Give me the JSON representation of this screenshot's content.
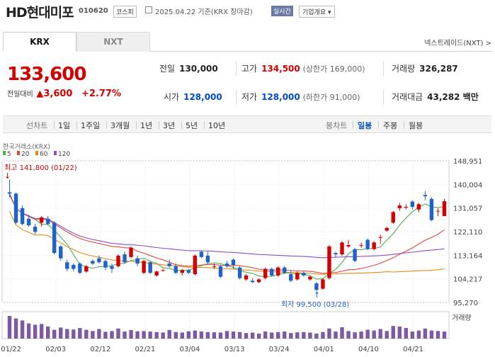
{
  "header": {
    "company": "HD현대미포",
    "code": "010620",
    "market": "코스피",
    "date_text": "2025.04.22  기준(KRX 장마감)",
    "realtime_label": "실시간",
    "company_info_label": "기업개요 ▾"
  },
  "tabs": [
    "KRX",
    "NXT"
  ],
  "nextrade_link": "넥스트레이드(NXT) >",
  "quote": {
    "price": "133,600",
    "change_label": "전일대비",
    "change": "▲3,600",
    "change_pct": "+2.77%"
  },
  "stats": {
    "prev_label": "전일",
    "prev": "130,000",
    "high_label": "고가",
    "high": "134,500",
    "upper_limit": "(상한가 169,000)",
    "volume_label": "거래량",
    "volume": "326,287",
    "open_label": "시가",
    "open": "128,000",
    "low_label": "저가",
    "low": "128,000",
    "lower_limit": "(하한가 91,000)",
    "amount_label": "거래대금",
    "amount": "43,282 백만"
  },
  "toolbar": {
    "line_chart": "선차트",
    "periods": [
      "1일",
      "1주일",
      "3개월",
      "1년",
      "3년",
      "5년",
      "10년"
    ],
    "candle_chart": "봉차트",
    "candle_periods": [
      "일봉",
      "주봉",
      "월봉"
    ]
  },
  "chart_data": {
    "type": "candlestick",
    "source_label": "한국거래소(KRX)",
    "legend": [
      {
        "name": "5",
        "color": "#4caf50"
      },
      {
        "name": "20",
        "color": "#e0463c"
      },
      {
        "name": "60",
        "color": "#e38a14"
      },
      {
        "name": "120",
        "color": "#8a4fc8"
      }
    ],
    "up_color": "#d20000",
    "down_color": "#1e63c8",
    "y_ticks": [
      "148,951",
      "140,004",
      "131,057",
      "122,110",
      "113,164",
      "104,217",
      "95,270"
    ],
    "ylim": [
      95270,
      148951
    ],
    "x_ticks": [
      "01/22",
      "02/03",
      "02/12",
      "02/21",
      "03/04",
      "03/13",
      "03/24",
      "04/01",
      "04/10",
      "04/21"
    ],
    "high_annotation": "최고 141,800 (01/22)",
    "low_annotation": "최저 99,500 (03/28)",
    "volume_label": "거래량",
    "candles": [
      [
        137000,
        141800,
        135000,
        136500
      ],
      [
        136500,
        137000,
        125000,
        125500
      ],
      [
        131000,
        132000,
        124500,
        125000
      ],
      [
        127000,
        128500,
        124000,
        124500
      ],
      [
        124000,
        125000,
        121000,
        122000
      ],
      [
        125500,
        128000,
        124000,
        127500
      ],
      [
        127000,
        128000,
        124500,
        125000
      ],
      [
        125500,
        126000,
        113500,
        114000
      ],
      [
        116500,
        117000,
        111000,
        112000
      ],
      [
        110500,
        111500,
        107000,
        108000
      ],
      [
        109500,
        110000,
        107000,
        108000
      ],
      [
        110000,
        110500,
        106000,
        106500
      ],
      [
        107000,
        109500,
        106500,
        109000
      ],
      [
        111000,
        111500,
        109500,
        110000
      ],
      [
        112000,
        113000,
        110000,
        110500
      ],
      [
        111000,
        111500,
        107500,
        108500
      ],
      [
        109000,
        110000,
        106500,
        108000
      ],
      [
        109000,
        113500,
        108500,
        113000
      ],
      [
        113500,
        114500,
        110000,
        110500
      ],
      [
        112500,
        116500,
        112000,
        116000
      ],
      [
        112000,
        113000,
        109000,
        110000
      ],
      [
        106500,
        111500,
        106000,
        111000
      ],
      [
        110500,
        111000,
        106000,
        106500
      ],
      [
        105500,
        107500,
        105000,
        107000
      ],
      [
        107500,
        108000,
        107000,
        107500
      ],
      [
        110000,
        111500,
        108500,
        109000
      ],
      [
        109000,
        110000,
        106000,
        106500
      ],
      [
        106500,
        108000,
        105500,
        107500
      ],
      [
        107500,
        108000,
        106000,
        106500
      ],
      [
        106000,
        113500,
        105500,
        113000
      ],
      [
        114500,
        115000,
        112000,
        112500
      ],
      [
        113000,
        114500,
        110000,
        110500
      ],
      [
        109000,
        110000,
        108000,
        109000
      ],
      [
        109000,
        109500,
        104500,
        105000
      ],
      [
        110000,
        111000,
        108500,
        109000
      ],
      [
        111500,
        112000,
        108000,
        109500
      ],
      [
        108500,
        109000,
        104000,
        104500
      ],
      [
        104000,
        106000,
        103500,
        105500
      ],
      [
        103500,
        104500,
        102500,
        103000
      ],
      [
        103000,
        104500,
        102500,
        104000
      ],
      [
        104500,
        108500,
        104000,
        108000
      ],
      [
        108000,
        108500,
        105000,
        105500
      ],
      [
        105500,
        109000,
        105000,
        108500
      ],
      [
        108500,
        109000,
        106000,
        106500
      ],
      [
        106000,
        107500,
        103000,
        103500
      ],
      [
        104000,
        107000,
        103500,
        106500
      ],
      [
        106500,
        107000,
        105000,
        105500
      ],
      [
        104000,
        105500,
        103500,
        105000
      ],
      [
        102500,
        103000,
        99500,
        100000
      ],
      [
        100500,
        104500,
        100000,
        104000
      ],
      [
        104500,
        117000,
        104000,
        116500
      ],
      [
        114000,
        114500,
        112500,
        113500
      ],
      [
        113500,
        118500,
        113000,
        118000
      ],
      [
        116500,
        119000,
        116000,
        117000
      ],
      [
        115500,
        116000,
        110500,
        111000
      ],
      [
        117000,
        118000,
        116000,
        117000
      ],
      [
        119000,
        119500,
        115000,
        115500
      ],
      [
        115500,
        118500,
        115000,
        118000
      ],
      [
        120000,
        121000,
        117500,
        120000
      ],
      [
        122500,
        124000,
        122000,
        123500
      ],
      [
        125500,
        130000,
        125000,
        129500
      ],
      [
        131000,
        133000,
        130000,
        132000
      ],
      [
        131500,
        132500,
        130500,
        131500
      ],
      [
        133500,
        134000,
        130500,
        131500
      ],
      [
        130500,
        133000,
        129500,
        132500
      ],
      [
        136000,
        137500,
        134000,
        135500
      ],
      [
        134500,
        135000,
        126000,
        126500
      ],
      [
        130000,
        131000,
        128000,
        130000
      ],
      [
        128000,
        134500,
        128000,
        133600
      ]
    ],
    "volumes": [
      90,
      80,
      72,
      60,
      55,
      58,
      48,
      35,
      44,
      38,
      36,
      42,
      35,
      30,
      38,
      27,
      30,
      40,
      28,
      34,
      29,
      30,
      28,
      26,
      24,
      34,
      26,
      24,
      29,
      32,
      28,
      26,
      25,
      24,
      30,
      28,
      26,
      22,
      24,
      20,
      28,
      24,
      26,
      28,
      22,
      25,
      26,
      24,
      20,
      26,
      40,
      28,
      45,
      30,
      25,
      28,
      35,
      32,
      38,
      30,
      50,
      48,
      42,
      28,
      32,
      40,
      32,
      30,
      28
    ]
  }
}
